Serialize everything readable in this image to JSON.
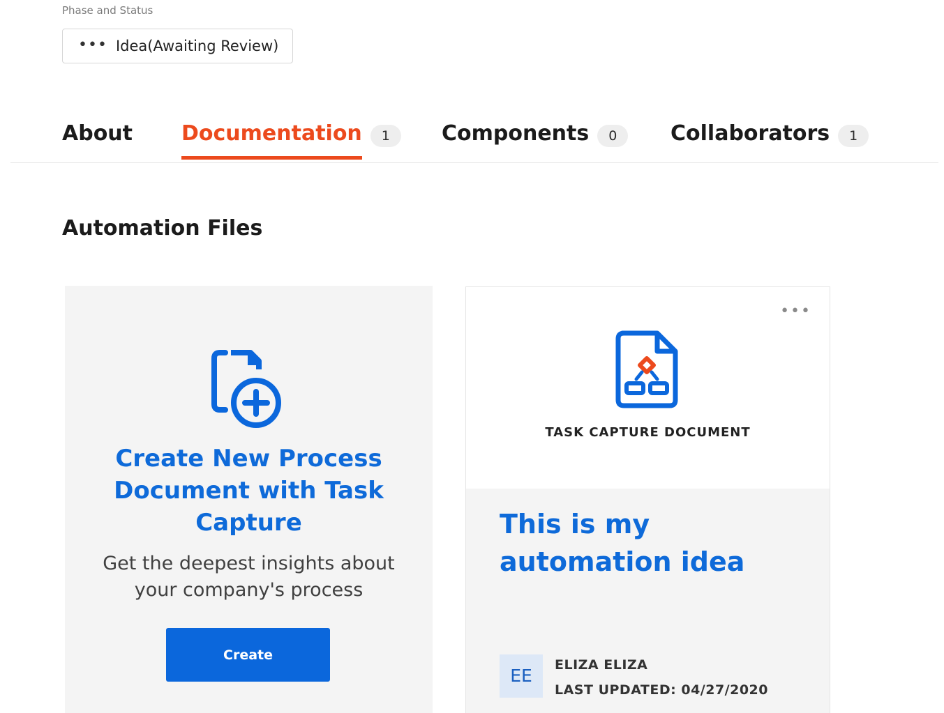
{
  "phase": {
    "label": "Phase and Status",
    "dots": "•••",
    "value": "Idea(Awaiting Review)"
  },
  "tabs": [
    {
      "label": "About",
      "count": null,
      "active": false
    },
    {
      "label": "Documentation",
      "count": "1",
      "active": true
    },
    {
      "label": "Components",
      "count": "0",
      "active": false
    },
    {
      "label": "Collaborators",
      "count": "1",
      "active": false
    }
  ],
  "section": {
    "title": "Automation Files"
  },
  "create_card": {
    "icon": "file-add-icon",
    "title": "Create New Process Document with Task Capture",
    "description": "Get the deepest insights about your company's process",
    "button_label": "Create"
  },
  "document_card": {
    "menu": "•••",
    "icon": "process-document-icon",
    "type": "TASK CAPTURE DOCUMENT",
    "title": "This is my automation idea",
    "avatar_initials": "EE",
    "author": "ELIZA ELIZA",
    "updated": "LAST UPDATED: 04/27/2020"
  },
  "colors": {
    "accent": "#ec4a1d",
    "primary": "#0b67dc",
    "link": "#0e6ad9"
  }
}
